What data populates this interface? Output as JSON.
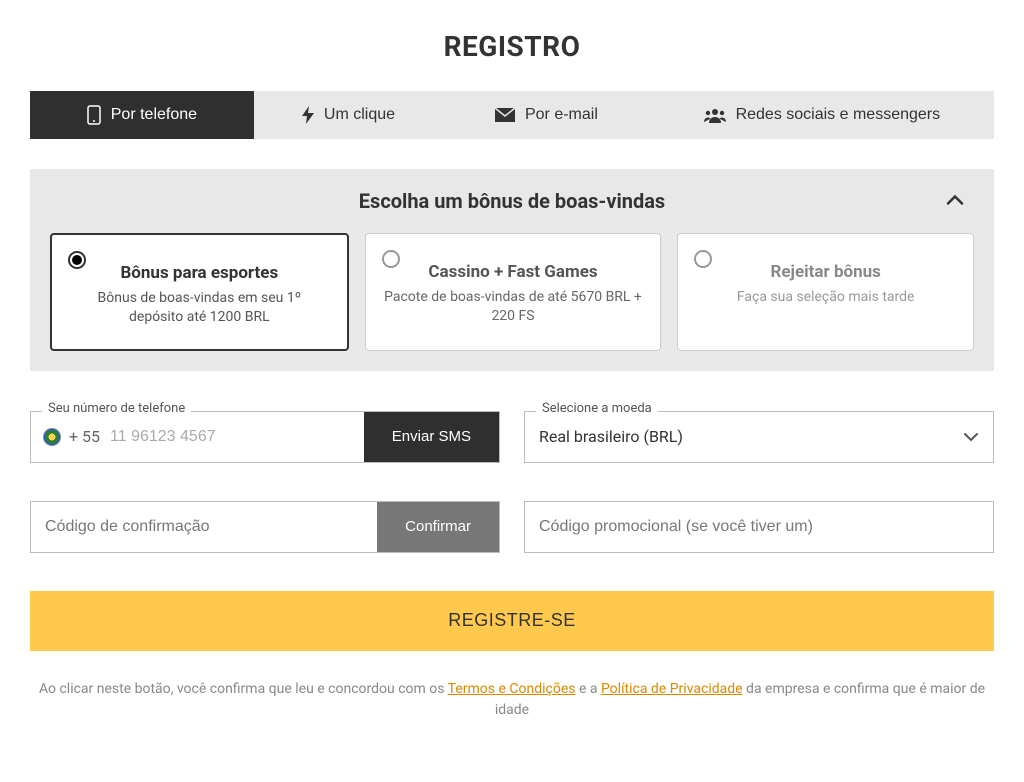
{
  "title": "REGISTRO",
  "tabs": [
    {
      "label": "Por telefone",
      "icon": "phone-icon"
    },
    {
      "label": "Um clique",
      "icon": "bolt-icon"
    },
    {
      "label": "Por e-mail",
      "icon": "mail-icon"
    },
    {
      "label": "Redes sociais e messengers",
      "icon": "users-icon"
    }
  ],
  "bonus": {
    "heading": "Escolha um bônus de boas-vindas",
    "options": [
      {
        "title": "Bônus para esportes",
        "desc": "Bônus de boas-vindas em seu 1º depósito até 1200 BRL",
        "selected": true
      },
      {
        "title": "Cassino + Fast Games",
        "desc": "Pacote de boas-vindas de até 5670 BRL + 220 FS",
        "selected": false
      },
      {
        "title": "Rejeitar bônus",
        "desc": "Faça sua seleção mais tarde",
        "selected": false
      }
    ]
  },
  "phone": {
    "label": "Seu número de telefone",
    "prefix": "+ 55",
    "placeholder": "11 96123 4567",
    "send_sms": "Enviar SMS"
  },
  "currency": {
    "label": "Selecione a moeda",
    "value": "Real brasileiro (BRL)"
  },
  "confirm": {
    "placeholder": "Código de confirmação",
    "button": "Confirmar"
  },
  "promo": {
    "placeholder": "Código promocional (se você tiver um)"
  },
  "submit": "REGISTRE-SE",
  "disclaimer": {
    "before": "Ao clicar neste botão, você confirma que leu e concordou com os ",
    "terms": "Termos e Condições",
    "mid": " e a ",
    "privacy": "Política de Privacidade",
    "after": " da empresa e confirma que é maior de idade"
  }
}
